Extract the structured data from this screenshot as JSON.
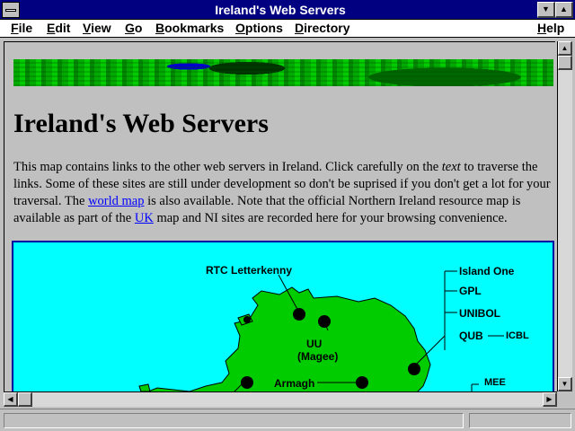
{
  "window": {
    "title": "Ireland's Web Servers"
  },
  "menu": {
    "items": [
      "File",
      "Edit",
      "View",
      "Go",
      "Bookmarks",
      "Options",
      "Directory",
      "Help"
    ]
  },
  "page": {
    "heading": "Ireland's Web Servers",
    "paragraph": {
      "part1": "This map contains links to the other web servers in Ireland. Click carefully on the ",
      "emphasis": "text",
      "part2": " to traverse the links. Some of these sites are still under development so don't be suprised if you don't get a lot for your traversal. The ",
      "link_world_map": "world map",
      "part3": " is also available. Note that the official Northern Ireland resource map is available as part of the ",
      "link_uk": "UK",
      "part4": " map and NI sites are recorded here for your browsing convenience."
    },
    "map_labels": {
      "rtc": "RTC Letterkenny",
      "island_one": "Island One",
      "gpl": "GPL",
      "unibol": "UNIBOL",
      "qub": "QUB",
      "icbl": "ICBL",
      "uu_1": "UU",
      "uu_2": "(Magee)",
      "armagh": "Armagh",
      "mee": "MEE"
    }
  },
  "colors": {
    "titlebar": "#000080",
    "map_sea": "#00ffff",
    "map_land": "#00cc00",
    "link": "#0000ff"
  },
  "icons": {
    "system_menu": "system-menu-icon",
    "minimize": "minimize-icon",
    "maximize": "maximize-icon",
    "scroll_up": "scroll-up-icon",
    "scroll_down": "scroll-down-icon",
    "scroll_left": "scroll-left-icon",
    "scroll_right": "scroll-right-icon"
  },
  "status": {
    "text": ""
  }
}
